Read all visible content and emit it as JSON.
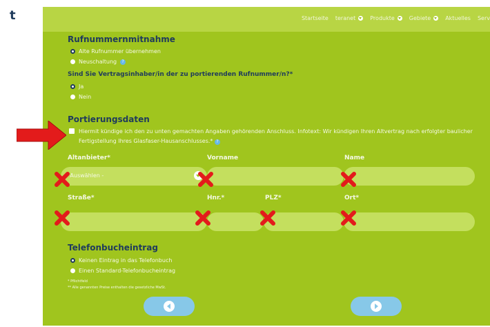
{
  "logo": {
    "fragment": "t"
  },
  "nav": {
    "items": [
      "Startseite",
      "teranet",
      "Produkte",
      "Gebiete",
      "Aktuelles",
      "Serv"
    ]
  },
  "porting": {
    "title": "Rufnummernmitnahme",
    "options": [
      "Alte Rufnummer übernehmen",
      "Neuschaltung"
    ],
    "selected": 0
  },
  "contract": {
    "question": "Sind Sie Vertragsinhaber/in der zu portierenden Rufnummer/n?*",
    "options": [
      "Ja",
      "Nein"
    ],
    "selected": 0
  },
  "portdata": {
    "title": "Portierungsdaten",
    "checkbox_label": "Hiermit kündige ich den zu unten gemachten Angaben gehörenden Anschluss. Infotext: Wir kündigen Ihren Altvertrag nach erfolgter baulicher Fertigstellung Ihres Glasfaser-Hausanschlusses.*",
    "checked": false
  },
  "fields": {
    "provider": {
      "label": "Altanbieter*",
      "value": "- Auswählen -"
    },
    "firstname": {
      "label": "Vorname",
      "value": ""
    },
    "lastname": {
      "label": "Name",
      "value": ""
    },
    "street": {
      "label": "Straße*",
      "value": ""
    },
    "housenr": {
      "label": "Hnr.*",
      "value": ""
    },
    "zip": {
      "label": "PLZ*",
      "value": ""
    },
    "city": {
      "label": "Ort*",
      "value": ""
    }
  },
  "phonebook": {
    "title": "Telefonbucheintrag",
    "options": [
      "Keinen Eintrag in das Telefonbuch",
      "Einen Standard-Telefonbucheintrag"
    ],
    "selected": 0
  },
  "notes": {
    "required": "* Pflichtfeld",
    "prices": "** Alle genannten Preise enthalten die gesetzliche MwSt."
  },
  "annotation_colors": {
    "cross": "#e31b1b",
    "arrow": "#e31b1b"
  },
  "colors": {
    "panel": "#a0c51e",
    "heading": "#1f3b5c",
    "button": "#87c8e8"
  }
}
